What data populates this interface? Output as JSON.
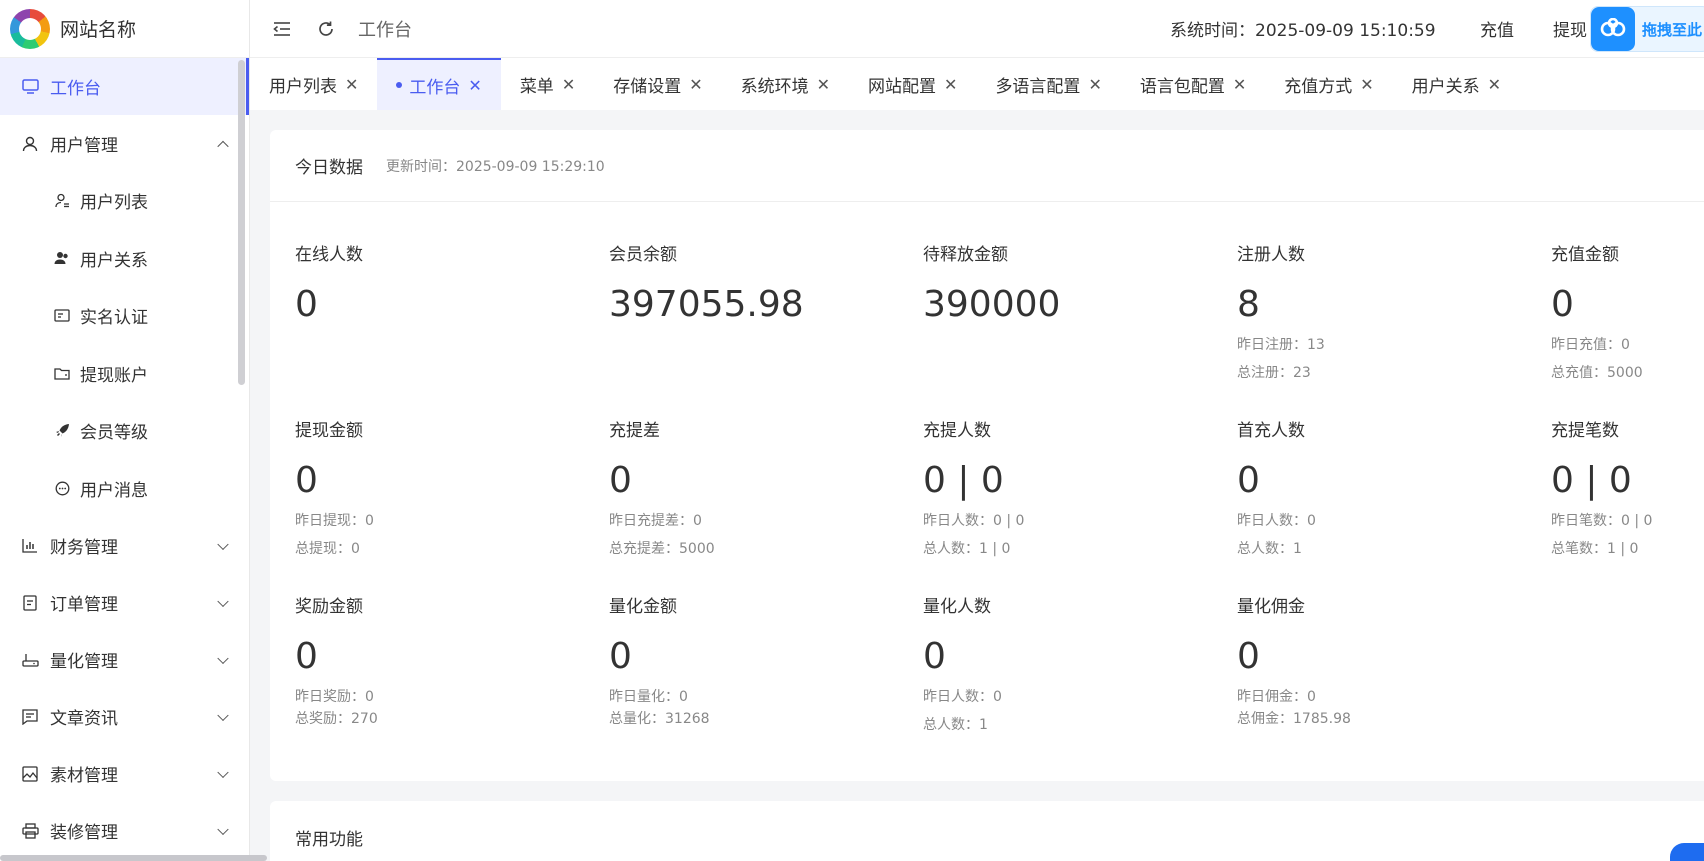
{
  "brand": {
    "name": "网站名称"
  },
  "sidebar": {
    "items": [
      {
        "label": "工作台",
        "icon": "monitor-icon",
        "active": true
      },
      {
        "label": "用户管理",
        "icon": "user-icon",
        "expanded": true,
        "children": [
          {
            "label": "用户列表",
            "icon": "user-list-icon"
          },
          {
            "label": "用户关系",
            "icon": "users-relation-icon"
          },
          {
            "label": "实名认证",
            "icon": "id-card-icon"
          },
          {
            "label": "提现账户",
            "icon": "wallet-icon"
          },
          {
            "label": "会员等级",
            "icon": "rocket-icon"
          },
          {
            "label": "用户消息",
            "icon": "message-icon"
          }
        ]
      },
      {
        "label": "财务管理",
        "icon": "chart-icon"
      },
      {
        "label": "订单管理",
        "icon": "order-icon"
      },
      {
        "label": "量化管理",
        "icon": "router-icon"
      },
      {
        "label": "文章资讯",
        "icon": "article-icon"
      },
      {
        "label": "素材管理",
        "icon": "image-icon"
      },
      {
        "label": "装修管理",
        "icon": "printer-icon"
      }
    ]
  },
  "header": {
    "title": "工作台",
    "system_time": "系统时间：2025-09-09 15:10:59",
    "recharge": "充值",
    "withdraw": "提现",
    "drag_widget": "拖拽至此"
  },
  "tabs": [
    {
      "label": "用户列表",
      "active": false
    },
    {
      "label": "工作台",
      "active": true
    },
    {
      "label": "菜单",
      "active": false
    },
    {
      "label": "存储设置",
      "active": false
    },
    {
      "label": "系统环境",
      "active": false
    },
    {
      "label": "网站配置",
      "active": false
    },
    {
      "label": "多语言配置",
      "active": false
    },
    {
      "label": "语言包配置",
      "active": false
    },
    {
      "label": "充值方式",
      "active": false
    },
    {
      "label": "用户关系",
      "active": false
    }
  ],
  "today": {
    "title": "今日数据",
    "updated": "更新时间：2025-09-09 15:29:10",
    "stats": [
      {
        "label": "在线人数",
        "value": "0",
        "subs": []
      },
      {
        "label": "会员余额",
        "value": "397055.98",
        "subs": []
      },
      {
        "label": "待释放金额",
        "value": "390000",
        "subs": []
      },
      {
        "label": "注册人数",
        "value": "8",
        "subs": [
          "昨日注册：13",
          "总注册：23"
        ]
      },
      {
        "label": "充值金额",
        "value": "0",
        "subs": [
          "昨日充值：0",
          "总充值：5000"
        ]
      },
      {
        "label": "提现金额",
        "value": "0",
        "subs": [
          "昨日提现：0",
          "总提现：0"
        ]
      },
      {
        "label": "充提差",
        "value": "0",
        "subs": [
          "昨日充提差：0",
          "总充提差：5000"
        ]
      },
      {
        "label": "充提人数",
        "value": "0 | 0",
        "subs": [
          "昨日人数：0 | 0",
          "总人数：1 | 0"
        ]
      },
      {
        "label": "首充人数",
        "value": "0",
        "subs": [
          "昨日人数：0",
          "总人数：1"
        ]
      },
      {
        "label": "充提笔数",
        "value": "0 | 0",
        "subs": [
          "昨日笔数：0 | 0",
          "总笔数：1 | 0"
        ]
      },
      {
        "label": "奖励金额",
        "value": "0",
        "subs": [
          "昨日奖励：0",
          "总奖励：270"
        ]
      },
      {
        "label": "量化金额",
        "value": "0",
        "subs": [
          "昨日量化：0",
          "总量化：31268"
        ]
      },
      {
        "label": "量化人数",
        "value": "0",
        "subs": [
          "昨日人数：0",
          "总人数：1"
        ]
      },
      {
        "label": "量化佣金",
        "value": "0",
        "subs": [
          "昨日佣金：0",
          "总佣金：1785.98"
        ]
      }
    ]
  },
  "common": {
    "title": "常用功能"
  },
  "colors": {
    "accent": "#4a5cf0",
    "widget": "#1e90ff"
  }
}
